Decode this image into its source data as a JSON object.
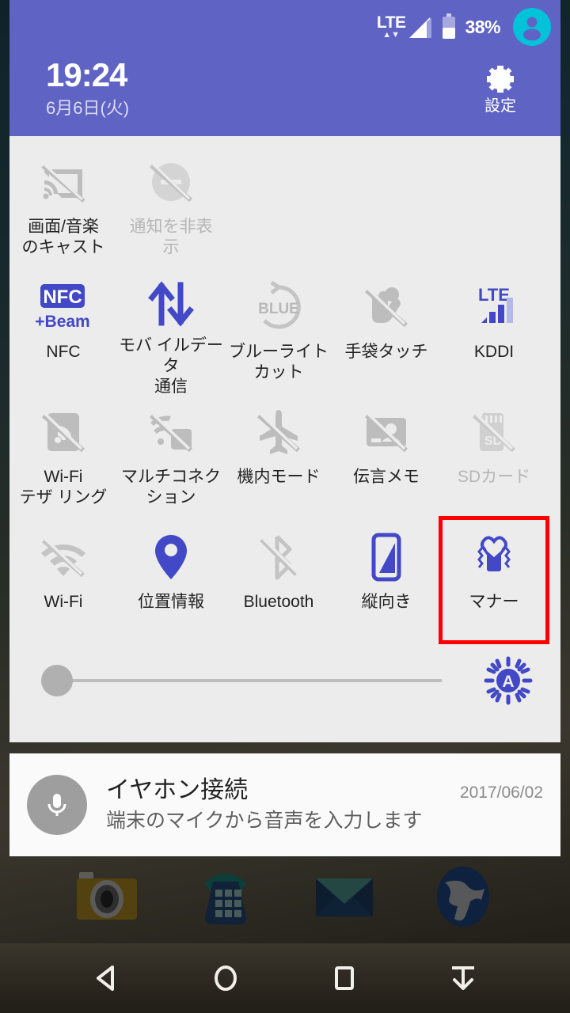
{
  "statusbar": {
    "network_type": "LTE",
    "data_arrows": "▲▼",
    "battery_percent": "38%",
    "avatar_icon": "user-avatar-icon",
    "signal_icon": "signal-bars-icon",
    "battery_icon": "battery-icon"
  },
  "header": {
    "time": "19:24",
    "date": "6月6日(火)",
    "settings_label": "設定",
    "settings_icon": "gear-icon",
    "background_color": "#5f63c4"
  },
  "tiles": [
    [
      {
        "label": "画面/音楽\nのキャスト",
        "label_line1": "画面/音楽",
        "label_line2": "のキャスト",
        "icon": "cast-off-icon",
        "state": "off",
        "enabled": true
      },
      {
        "label": "通知を非表\n示",
        "label_line1": "通知を非表",
        "label_line2": "示",
        "icon": "do-not-disturb-off-icon",
        "state": "disabled",
        "enabled": false
      }
    ],
    [
      {
        "label": "NFC",
        "icon": "nfc-beam-icon",
        "state": "on",
        "enabled": true
      },
      {
        "label": "モバイルデータ\n通信",
        "label_line1": "モバ イルデータ",
        "label_line2": "通信",
        "icon": "mobile-data-icon",
        "state": "on",
        "enabled": true
      },
      {
        "label": "ブルーライトカット",
        "icon": "blue-light-cut-icon",
        "state": "off",
        "enabled": true
      },
      {
        "label": "手袋タッチ",
        "icon": "glove-touch-off-icon",
        "state": "off",
        "enabled": true
      },
      {
        "label": "KDDI",
        "icon": "carrier-lte-icon",
        "state": "on",
        "enabled": true
      }
    ],
    [
      {
        "label": "Wi-Fi\nテザリング",
        "label_line1": "Wi-Fi",
        "label_line2": "テザ リング",
        "icon": "wifi-tethering-off-icon",
        "state": "off",
        "enabled": true
      },
      {
        "label": "マルチコネクション",
        "icon": "multi-connection-off-icon",
        "state": "off",
        "enabled": true
      },
      {
        "label": "機内モード",
        "icon": "airplane-mode-icon",
        "state": "off",
        "enabled": true
      },
      {
        "label": "伝言メモ",
        "icon": "voice-memo-off-icon",
        "state": "off",
        "enabled": true
      },
      {
        "label": "SDカード",
        "icon": "sd-card-off-icon",
        "state": "disabled",
        "enabled": false
      }
    ],
    [
      {
        "label": "Wi-Fi",
        "icon": "wifi-off-icon",
        "state": "off",
        "enabled": true
      },
      {
        "label": "位置情報",
        "icon": "location-pin-icon",
        "state": "on",
        "enabled": true
      },
      {
        "label": "Bluetooth",
        "icon": "bluetooth-off-icon",
        "state": "off",
        "enabled": true
      },
      {
        "label": "縦向き",
        "icon": "portrait-orientation-icon",
        "state": "on",
        "enabled": true
      },
      {
        "label": "マナー",
        "icon": "vibrate-manner-mode-icon",
        "state": "on",
        "enabled": true,
        "highlighted": true
      }
    ]
  ],
  "brightness": {
    "value_percent": 2,
    "auto_icon": "auto-brightness-icon",
    "auto_label": "A"
  },
  "notification": {
    "icon": "microphone-icon",
    "title": "イヤホン接続",
    "date": "2017/06/02",
    "text": "端末のマイクから音声を入力します"
  },
  "dock": [
    {
      "icon": "camera-app-icon"
    },
    {
      "icon": "phone-app-icon"
    },
    {
      "icon": "email-app-icon"
    },
    {
      "icon": "browser-app-icon"
    }
  ],
  "navbar": [
    {
      "icon": "back-icon"
    },
    {
      "icon": "home-icon"
    },
    {
      "icon": "recents-icon"
    },
    {
      "icon": "pull-down-icon"
    }
  ],
  "colors": {
    "accent_blue": "#4248c6",
    "header_purple": "#5f63c4",
    "panel_gray": "#ececec",
    "icon_gray": "#bdbdbd",
    "highlight_red": "#ff0000",
    "avatar_cyan": "#00c3d9"
  }
}
